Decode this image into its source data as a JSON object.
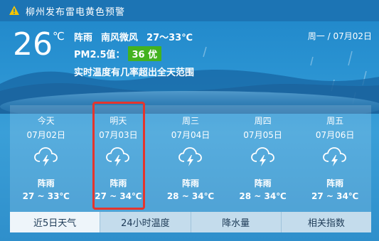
{
  "alert": {
    "text": "柳州发布雷电黄色预警"
  },
  "current": {
    "temperature": "26",
    "unit": "℃",
    "condition": "阵雨",
    "wind": "南风微风",
    "range": "27～33℃",
    "pm_label": "PM2.5值：",
    "aqi": "36 优",
    "aqi_color": "#43b21f",
    "description": "实时温度有几率超出全天范围",
    "date": "周一 / 07月02日"
  },
  "forecast": [
    {
      "name": "今天",
      "date": "07月02日",
      "icon": "thunderstorm-icon",
      "condition": "阵雨",
      "range": "27 ~ 33℃"
    },
    {
      "name": "明天",
      "date": "07月03日",
      "icon": "thunderstorm-icon",
      "condition": "阵雨",
      "range": "27 ~ 34℃"
    },
    {
      "name": "周三",
      "date": "07月04日",
      "icon": "thunderstorm-icon",
      "condition": "阵雨",
      "range": "28 ~ 34℃"
    },
    {
      "name": "周四",
      "date": "07月05日",
      "icon": "thunderstorm-icon",
      "condition": "阵雨",
      "range": "28 ~ 34℃"
    },
    {
      "name": "周五",
      "date": "07月06日",
      "icon": "thunderstorm-icon",
      "condition": "阵雨",
      "range": "27 ~ 34℃"
    }
  ],
  "tabs": [
    {
      "label": "近5日天气",
      "active": true
    },
    {
      "label": "24小时温度",
      "active": false
    },
    {
      "label": "降水量",
      "active": false
    },
    {
      "label": "相关指数",
      "active": false
    }
  ],
  "colors": {
    "highlight": "#e4352d",
    "topbar": "#1c74b4"
  }
}
